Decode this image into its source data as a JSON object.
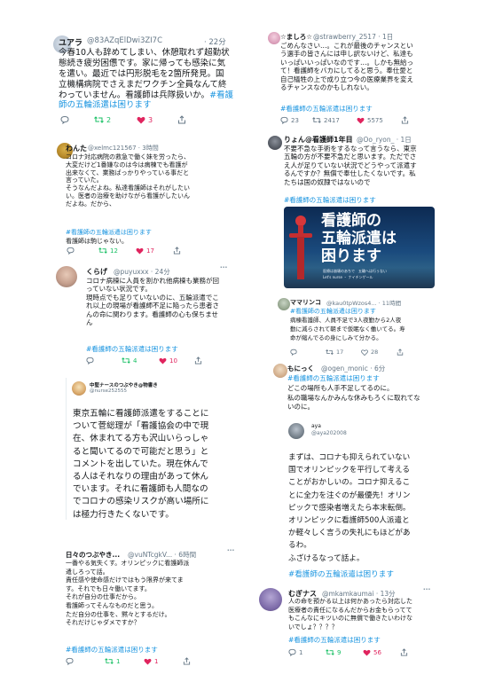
{
  "tweets": {
    "yuara": {
      "name": "ユアラ",
      "handle": "@83AZqElDwi3ZI7C",
      "time": "· 22分",
      "lines": [
        "今春10人も辞めてしまい、休憩取れず超勤状",
        "態続き疲労困憊です。家に帰っても感染に気",
        "を遣い。最近では円形脱毛を2箇所発見。国",
        "立機構病院でさえまだワクチン全員なんて終",
        "わっていません。看護師は兵隊扱いか。"
      ],
      "hashtag": "#看護",
      "hashtag2": "師の五輪派遣は困ります",
      "reply": "",
      "retweet": "2",
      "like": "3"
    },
    "wanta": {
      "name": "わんた",
      "handle": "@xelmc121567 · 3時間",
      "lines": [
        "コロナ対応病院の救急で働く妹を労ったら、",
        "大変だけど1番嫌なのは今は病棟でも看護が",
        "出来なくて、業務ばっかりやっている事だと",
        "言っていた。",
        "そうなんだよね。私達看護師はそれがしたい",
        "い。医者の治療を助けながら看護がしたいん",
        "だよね。だから、"
      ],
      "hashtag": "#看護師の五輪派遣は困ります",
      "quote": "看護師は駒じゃない。",
      "reply": "",
      "retweet": "12",
      "like": "17"
    },
    "kurage": {
      "name": "くらげ",
      "handle": "@puyuxxx · 24分",
      "lines": [
        "コロナ病棟に人員を割かれ他病棟も業務が回",
        "っていない状況です。",
        "現時点でも足りていないのに、五輪派遣でこ",
        "れ以上の現場が看護師不足に陥ったら患者さ",
        "んの命に関わります。看護師の心も保ちませ",
        "ん"
      ],
      "hashtag": "#看護師の五輪派遣は困ります",
      "reply": "",
      "retweet": "4",
      "like": "10"
    },
    "nurse": {
      "name": "中堅ナースのつぶやき@物書き",
      "handle": "@nurse252555",
      "lines": [
        "東京五輪に看護師派遣をすることに",
        "ついて菅総理が「看護協会の中で現",
        "在、休まれてる方も沢山いらっしゃ",
        "ると聞いてるので可能だと思う」と",
        "コメントを出していた。現在休んで",
        "る人はそれなりの理由があって休ん",
        "でいます。それに看護師も人間なの",
        "でコロナの感染リスクが高い場所に",
        "は極力行きたくないです。"
      ]
    },
    "hibino": {
      "name": "日々のつぶやき...",
      "handle": "@vuNTcgkV... · 6時間",
      "lines": [
        "一番やる気失くす。オリンピックに看護師派",
        "遣しろって話。",
        "責任感や使命感だけではもう限界が来てま",
        "す。それでも日々働いてます。",
        "それが自分の仕事だから。",
        "看護師ってそんなものだと思う。",
        "ただ自分の仕事を、黙々とするだけ。",
        "それだけじゃダメですか？"
      ],
      "hashtag": "#看護師の五輪派遣は困ります",
      "reply": "",
      "retweet": "1",
      "like": "1"
    },
    "mashiro": {
      "name": "☆ましろ☆",
      "handle": "@strawberry_2517 · 1日",
      "lines": [
        "ごめんなさい…。これが最後のチャンスとい",
        "う選手の皆さんには申し訳ないけど、私達も",
        "いっぱいいっぱいなのです…。しかも無給っ",
        "て！看護師をバカにしてると思う。奉仕愛と",
        "自己犠牲の上で成り立つ今の医療業界を変え",
        "るチャンスなのかもしれない。"
      ],
      "hashtag": "#看護師の五輪派遣は困ります",
      "reply": "23",
      "retweet": "2417",
      "like": "5575"
    },
    "ryon": {
      "name": "りょん@看護師1年目",
      "handle": "@Oo_ryon_ · 1日",
      "lines": [
        "不要不急な手術をするなって言うなら、東京",
        "五輪の方が不要不急だと思います。ただでさ",
        "え人が足りていない状況でどうやって派遣す",
        "るんですか？無償で奉仕したくないです。私",
        "たちは国の奴隷ではないので"
      ],
      "hashtag": "#看護師の五輪派遣は困ります",
      "banner_lines": [
        "看護師の",
        "五輪派遣は",
        "困ります"
      ],
      "banner_sub": "医療は崩壊のあちで　五輪へは行ぅない",
      "banner_sub2": "Let's nurse ・ ナイチンゲール"
    },
    "mamarinko": {
      "name": "ママリンコ",
      "handle": "@kau0tpWzos4... · 11時間",
      "hashtag": "#看護師の五輪派遣は困ります",
      "lines": [
        "病棟看護師、人員不足で3人夜勤から2人夜",
        "勤に減らされて朝まで仮眠なく働いてる。寿",
        "命が縮んでるの身にしみて分かる。"
      ],
      "reply": "",
      "retweet": "17",
      "like": "28"
    },
    "monikko": {
      "name": "もにっく",
      "handle": "@ogen_monic · 6分",
      "hashtag": "#看護師の五輪派遣は困ります",
      "lines": [
        "どこの場所も人手不足してるのに。",
        "私の職場なんかみんな休みもろくに取れてな",
        "いのに。"
      ],
      "quote_name": "aya",
      "quote_handle": "@aya202008",
      "quote_lines": [
        "まずは、コロナも抑えられていない",
        "国でオリンピックを平行して考える",
        "ことがおかしいの。コロナ抑えるこ",
        "とに全力を注ぐのが最優先！オリン",
        "ピックで感染者増えたら本末転倒。",
        "オリンピックに看護師500人派遣と",
        "か軽々しく言うの失礼にもほどがあ",
        "るわ。",
        "ふざけるなって話よ。"
      ],
      "quote_hashtag": "#看護師の五輪派遣は困ります"
    },
    "muginasu": {
      "name": "むぎナス",
      "handle": "@mkamkaumai · 13分",
      "lines": [
        "人の命を預かる以上は何かあったら対応した",
        "医療者の責任になるんだからお金もらってて",
        "もこんなにキツいのに無償で働きたいわけな",
        "いでしょ？？？？"
      ],
      "hashtag": "#看護師の五輪派遣は困ります",
      "reply": "1",
      "retweet": "9",
      "like": "56"
    }
  }
}
